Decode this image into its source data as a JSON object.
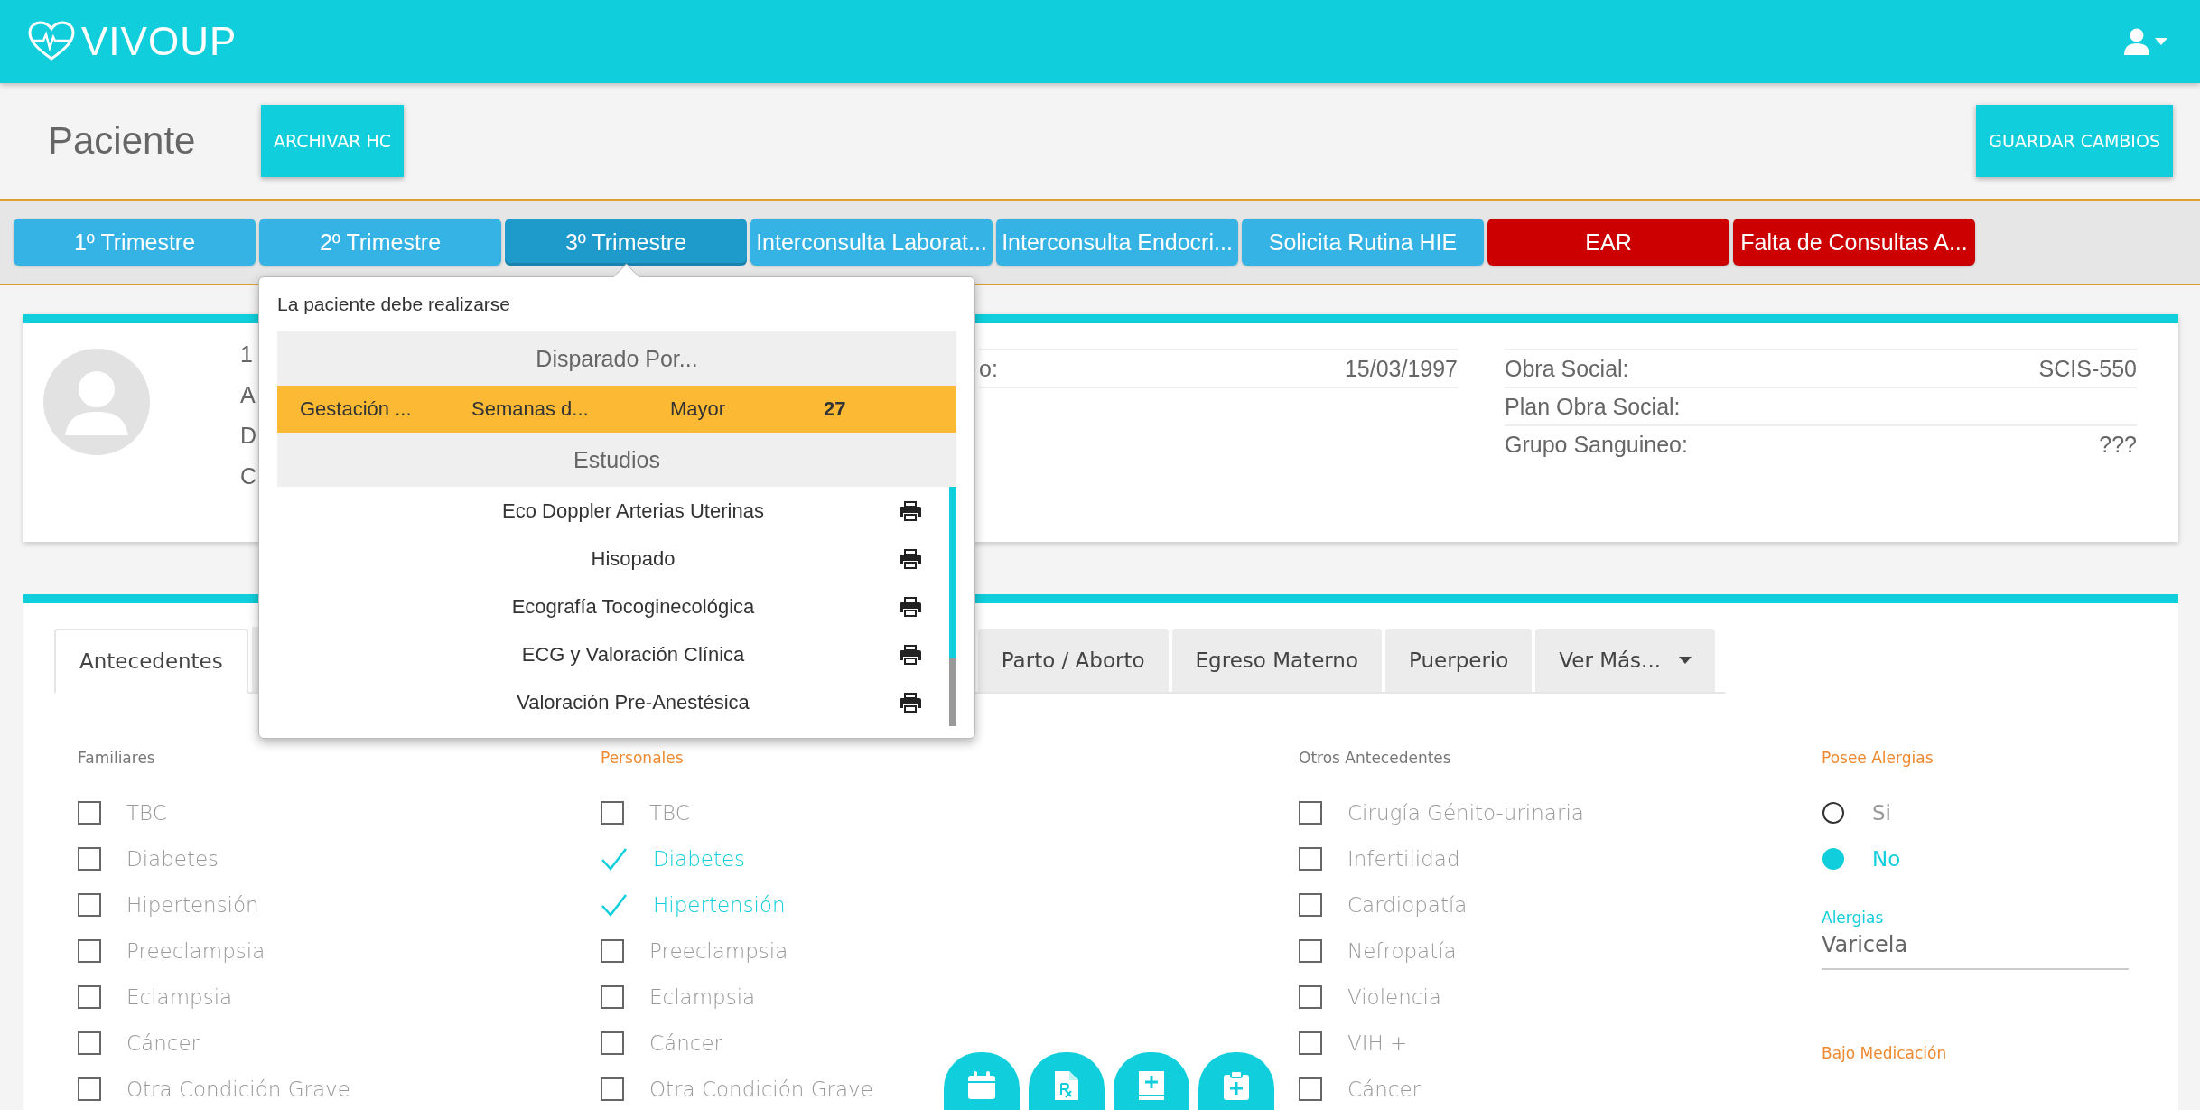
{
  "header": {
    "logo": "VIVOUP"
  },
  "page": {
    "title": "Paciente",
    "archive_button": "ARCHIVAR HC",
    "save_button": "GUARDAR CAMBIOS"
  },
  "alert_tabs": [
    {
      "label": "1º Trimestre",
      "color": "#35b3e5",
      "selected": false
    },
    {
      "label": "2º Trimestre",
      "color": "#35b3e5",
      "selected": false
    },
    {
      "label": "3º Trimestre",
      "color": "#1e9acb",
      "selected": true
    },
    {
      "label": "Interconsulta Laborat...",
      "color": "#35b3e5",
      "selected": false
    },
    {
      "label": "Interconsulta Endocri...",
      "color": "#35b3e5",
      "selected": false
    },
    {
      "label": "Solicita Rutina HIE",
      "color": "#35b3e5",
      "selected": false
    },
    {
      "label": "EAR",
      "color": "#cc0000",
      "selected": false
    },
    {
      "label": "Falta de Consultas A...",
      "color": "#cc0000",
      "selected": false
    }
  ],
  "patient_card": {
    "covered_fragments": [
      "1",
      "A",
      "D",
      "C"
    ],
    "middle_fields": [
      {
        "label": "o:",
        "value": "15/03/1997"
      }
    ],
    "right_fields": [
      {
        "label": "Obra Social:",
        "value": "SCIS-550"
      },
      {
        "label": "Plan Obra Social:"
      },
      {
        "label": "Grupo Sanguineo:",
        "value": "???"
      }
    ]
  },
  "popup": {
    "intro": "La paciente debe realizarse",
    "triggered_header": "Disparado Por...",
    "trigger_row": [
      "Gestación ...",
      "Semanas d...",
      "Mayor",
      "27"
    ],
    "studies_header": "Estudios",
    "studies": [
      "Eco Doppler Arterias Uterinas",
      "Hisopado",
      "Ecografía Tocoginecológica",
      "ECG y Valoración Clínica",
      "Valoración Pre-Anestésica"
    ]
  },
  "section_tabs": [
    {
      "label": "Antecedentes",
      "selected": true
    },
    {
      "label": "Parto / Aborto",
      "selected": false
    },
    {
      "label": "Egreso Materno",
      "selected": false
    },
    {
      "label": "Puerperio",
      "selected": false
    },
    {
      "label": "Ver Más...",
      "selected": false,
      "dropdown": true
    }
  ],
  "antecedent_columns": [
    {
      "title": "Familiares",
      "highlighted": false,
      "items": [
        {
          "label": "TBC",
          "checked": false
        },
        {
          "label": "Diabetes",
          "checked": false
        },
        {
          "label": "Hipertensión",
          "checked": false
        },
        {
          "label": "Preeclampsia",
          "checked": false
        },
        {
          "label": "Eclampsia",
          "checked": false
        },
        {
          "label": "Cáncer",
          "checked": false
        },
        {
          "label": "Otra Condición Grave",
          "checked": false
        }
      ]
    },
    {
      "title": "Personales",
      "highlighted": true,
      "items": [
        {
          "label": "TBC",
          "checked": false
        },
        {
          "label": "Diabetes",
          "checked": true
        },
        {
          "label": "Hipertensión",
          "checked": true
        },
        {
          "label": "Preeclampsia",
          "checked": false
        },
        {
          "label": "Eclampsia",
          "checked": false
        },
        {
          "label": "Cáncer",
          "checked": false
        },
        {
          "label": "Otra Condición Grave",
          "checked": false
        }
      ]
    },
    {
      "title": "Otros Antecedentes",
      "highlighted": false,
      "items": [
        {
          "label": "Cirugía Génito-urinaria",
          "checked": false
        },
        {
          "label": "Infertilidad",
          "checked": false
        },
        {
          "label": "Cardiopatía",
          "checked": false
        },
        {
          "label": "Nefropatía",
          "checked": false
        },
        {
          "label": "Violencia",
          "checked": false
        },
        {
          "label": "VIH +",
          "checked": false
        },
        {
          "label": "Cáncer",
          "checked": false
        }
      ]
    }
  ],
  "allergies": {
    "title": "Posee Alergias",
    "options": [
      {
        "label": "Si",
        "selected": false
      },
      {
        "label": "No",
        "selected": true
      }
    ],
    "field": {
      "label": "Alergias",
      "value": "Varicela"
    },
    "next_title": "Bajo Medicación"
  },
  "action_buttons": [
    {
      "kind": "calendar"
    },
    {
      "kind": "prescription"
    },
    {
      "kind": "book"
    },
    {
      "kind": "clipboard"
    }
  ]
}
